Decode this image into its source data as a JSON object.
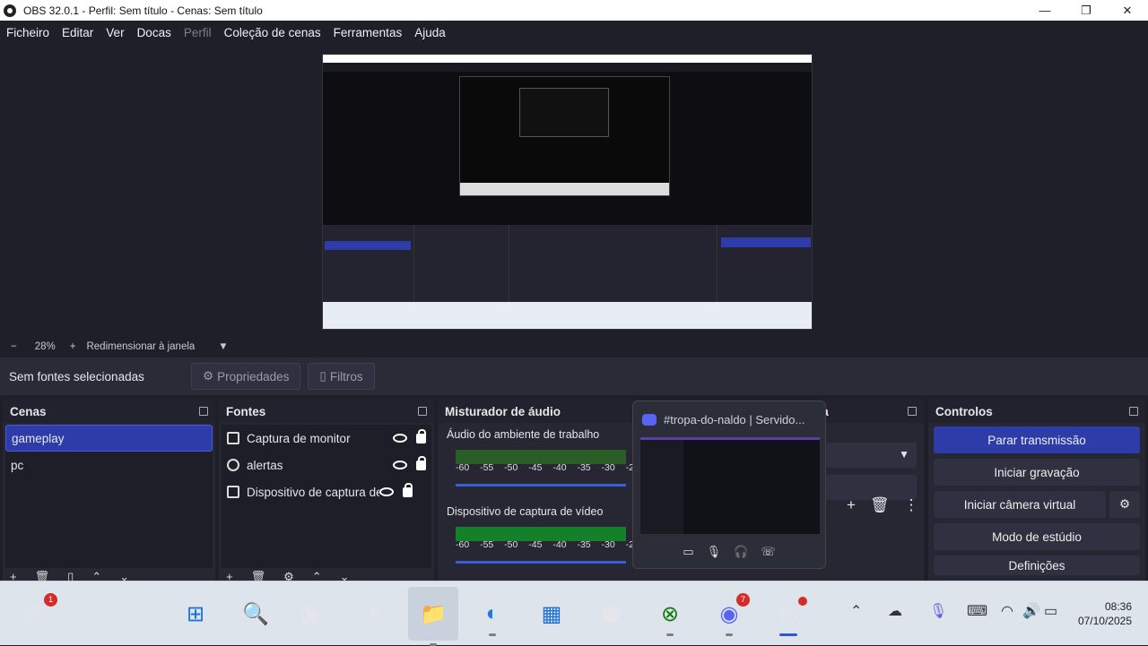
{
  "window": {
    "title": "OBS 32.0.1 - Perfil: Sem título - Cenas: Sem título",
    "minimize": "—",
    "maximize": "❐",
    "close": "✕"
  },
  "menu": [
    "Ficheiro",
    "Editar",
    "Ver",
    "Docas",
    "Perfil",
    "Coleção de cenas",
    "Ferramentas",
    "Ajuda"
  ],
  "menu_disabled": "Perfil",
  "zoom": {
    "minus": "−",
    "value": "28%",
    "plus": "+",
    "resize_label": "Redimensionar à janela",
    "dropdown": "▼"
  },
  "source_bar": {
    "label": "Sem fontes selecionadas",
    "properties": "Propriedades",
    "filters": "Filtros"
  },
  "scenes": {
    "title": "Cenas",
    "items": [
      "gameplay",
      "pc"
    ],
    "selected": "gameplay"
  },
  "sources": {
    "title": "Fontes",
    "items": [
      "Captura de monitor",
      "alertas",
      "Dispositivo de captura de"
    ]
  },
  "mixer": {
    "title": "Misturador de áudio",
    "channels": [
      "Áudio do ambiente de trabalho",
      "Dispositivo de captura de vídeo"
    ],
    "scale": "-60 -55 -50 -45 -40 -35 -30 -25 -20"
  },
  "transitions": {
    "title_fragment": "na"
  },
  "controls": {
    "title": "Controlos",
    "buttons": [
      "Parar transmissão",
      "Iniciar gravação",
      "Iniciar câmera virtual",
      "Modo de estúdio",
      "Definições"
    ]
  },
  "popup": {
    "title": "#tropa-do-naldo | Servido..."
  },
  "taskbar": {
    "weather_badge": "1",
    "discord_badge": "7",
    "time": "08:36",
    "date": "07/10/2025"
  },
  "colors": {
    "accent": "#2d3ca8",
    "bg": "#1e1f29",
    "dock": "#262733",
    "taskbar": "#dde4ec"
  }
}
